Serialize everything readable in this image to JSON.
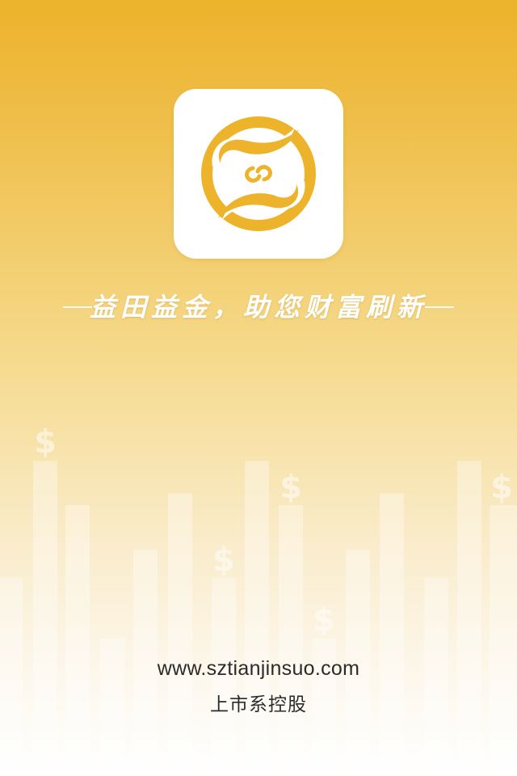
{
  "splash": {
    "slogan": "益田益金，助您财富刷新",
    "website": "www.sztianjinsuo.com",
    "tagline": "上市系控股"
  },
  "colors": {
    "gradient_top": "#ecb22a",
    "gradient_bottom": "#ffffff",
    "logo_gold": "#edb42b",
    "text_dark": "#2b2b2b"
  },
  "icons": [
    "app-logo-icon",
    "dollar-sign-icon"
  ]
}
